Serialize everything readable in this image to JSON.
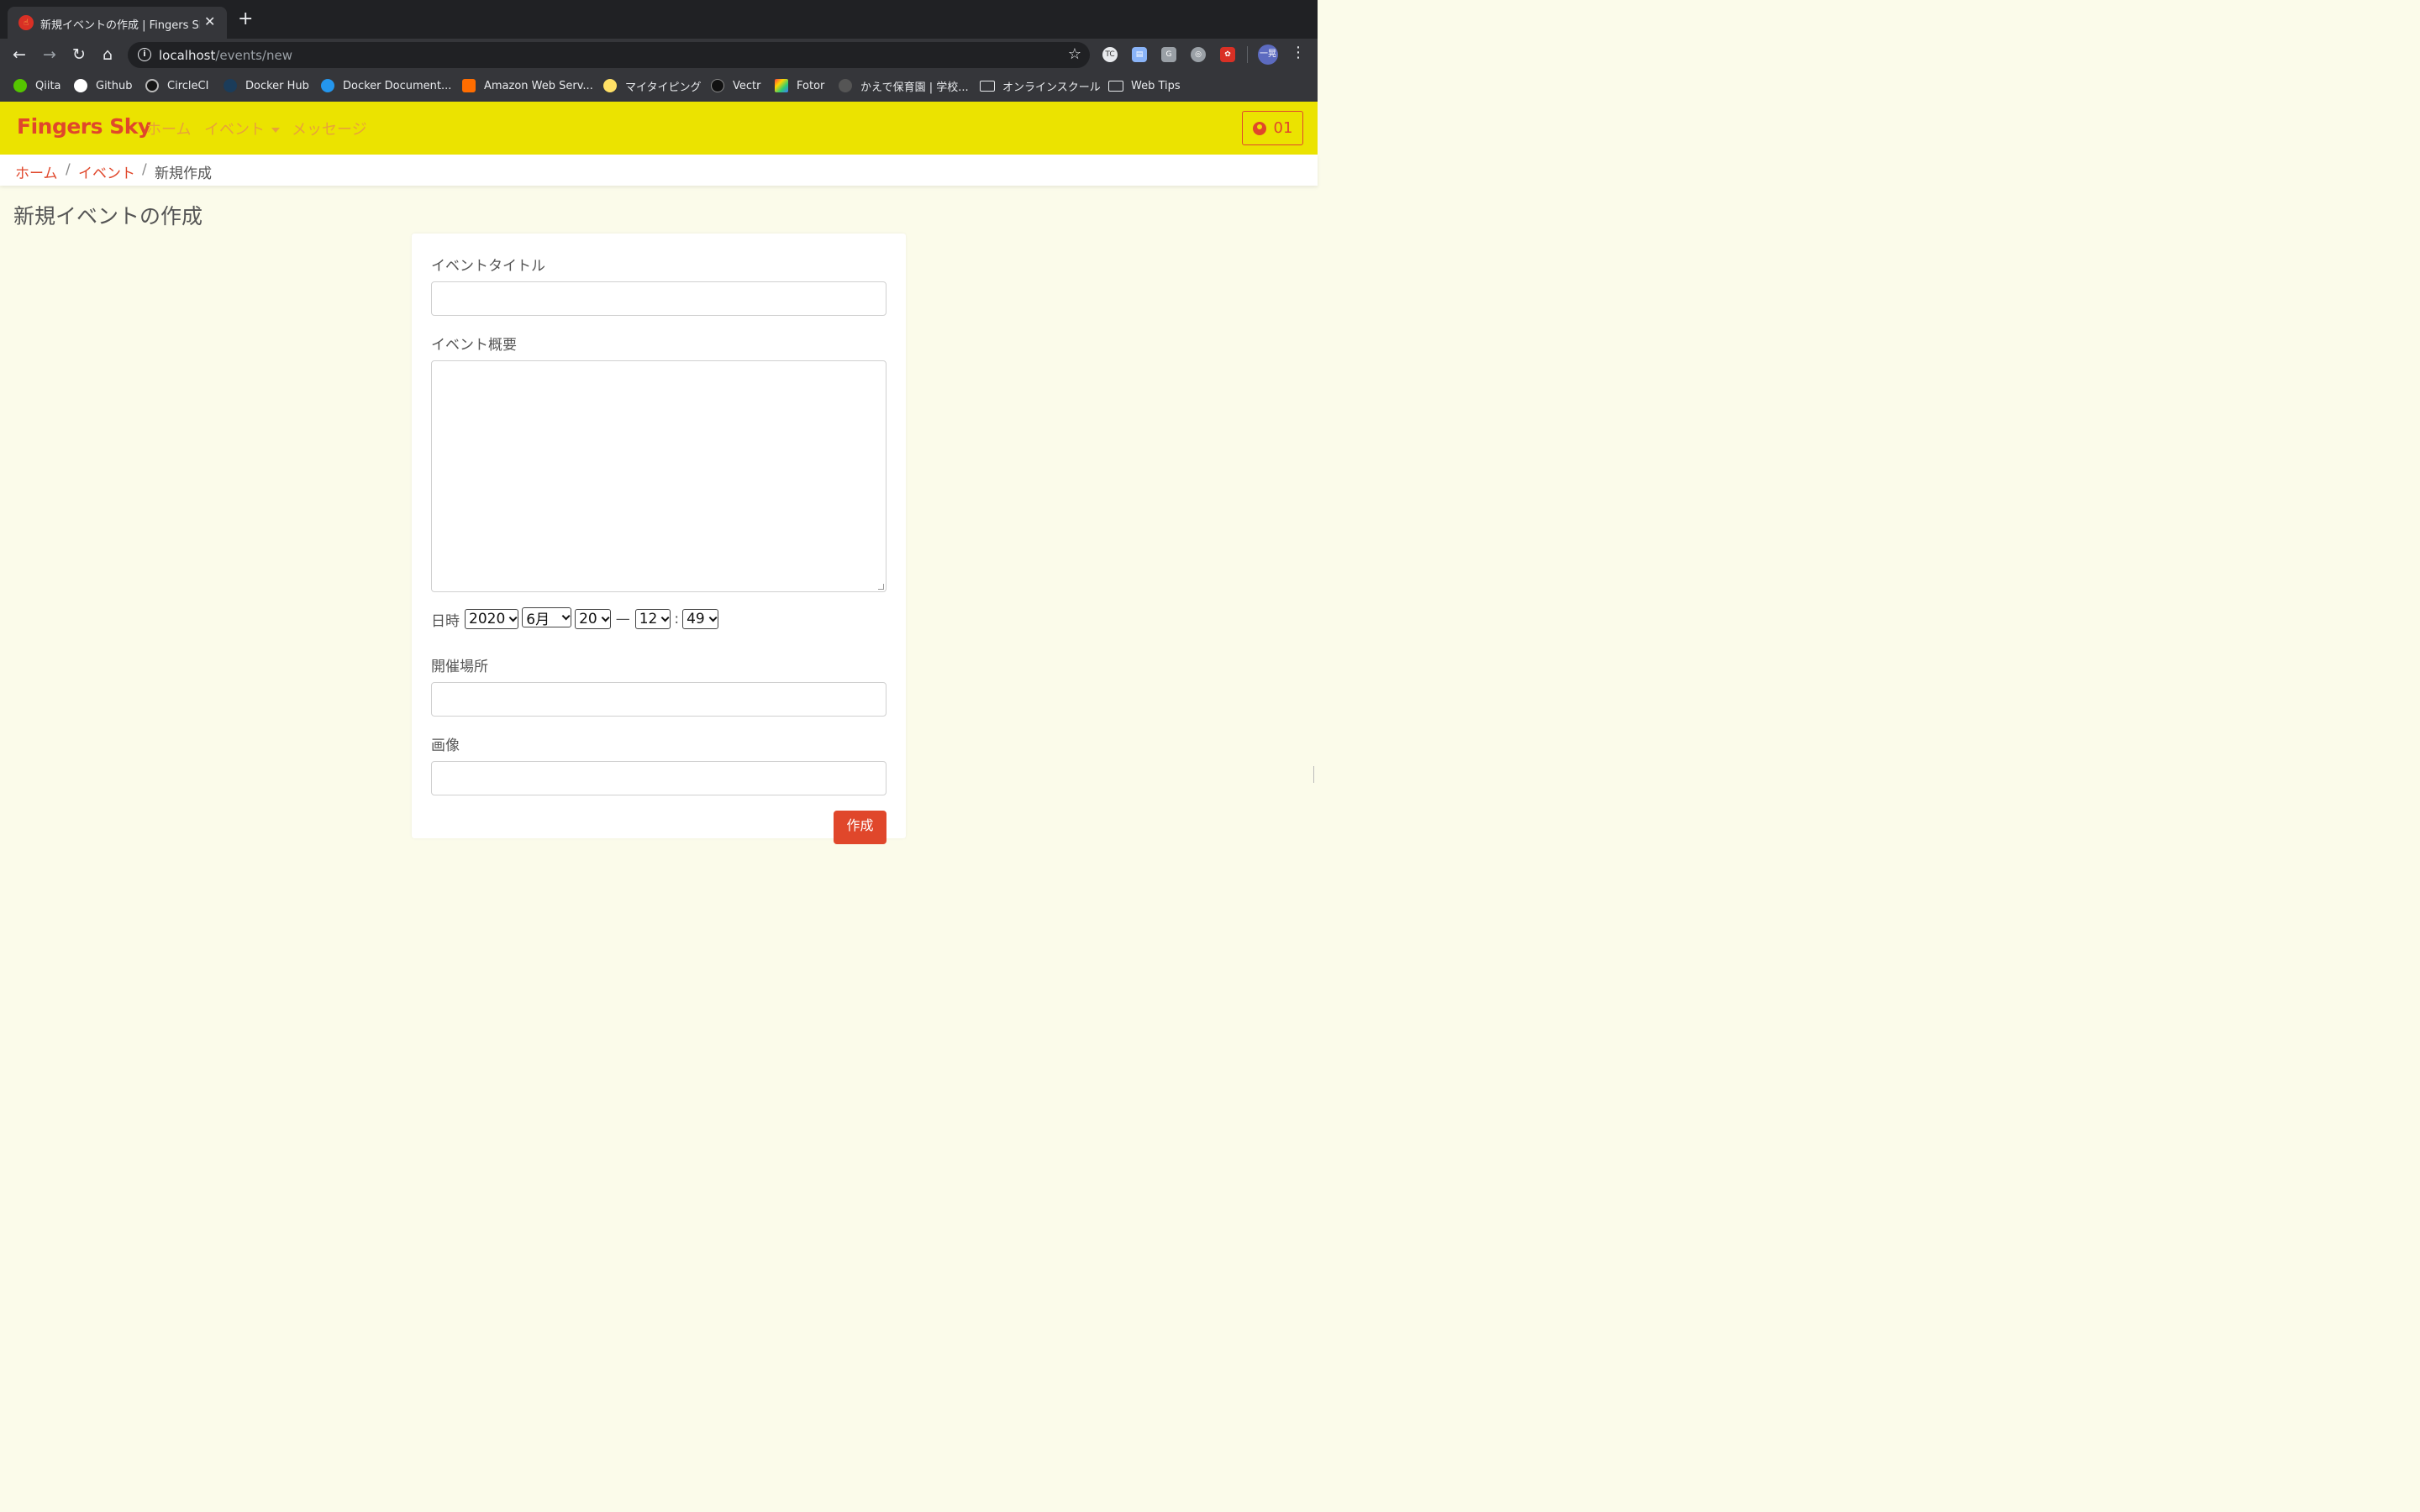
{
  "browser": {
    "tab_title": "新規イベントの作成 | Fingers Sky",
    "url_host": "localhost",
    "url_path": "/events/new",
    "profile_initials": "一晃",
    "bookmarks": [
      {
        "label": "Qiita",
        "color": "#55c500"
      },
      {
        "label": "Github",
        "color": "#ffffff"
      },
      {
        "label": "CircleCI",
        "color": "#161616"
      },
      {
        "label": "Docker Hub",
        "color": "#1d63ed"
      },
      {
        "label": "Docker Document...",
        "color": "#2496ed"
      },
      {
        "label": "Amazon Web Serv...",
        "color": "#ff9900"
      },
      {
        "label": "マイタイピング",
        "color": "#ffe066"
      },
      {
        "label": "Vectr",
        "color": "#111111"
      },
      {
        "label": "Fotor",
        "color": "#f4b400"
      },
      {
        "label": "かえで保育園 | 学校...",
        "color": "#777777"
      },
      {
        "label": "オンラインスクール",
        "color": "folder"
      },
      {
        "label": "Web Tips",
        "color": "folder"
      }
    ]
  },
  "navbar": {
    "brand": "Fingers Sky",
    "links": [
      "ホーム",
      "イベント",
      "メッセージ"
    ],
    "user_label": "01"
  },
  "breadcrumb": {
    "home": "ホーム",
    "sep": "/",
    "events": "イベント",
    "current": "新規作成"
  },
  "page": {
    "title": "新規イベントの作成"
  },
  "form": {
    "title_label": "イベントタイトル",
    "title_value": "",
    "summary_label": "イベント概要",
    "summary_value": "",
    "datetime_label": "日時",
    "year": "2020",
    "month": "6月",
    "day": "20",
    "dash": "—",
    "hour": "12",
    "colon": ":",
    "minute": "49",
    "place_label": "開催場所",
    "place_value": "",
    "image_label": "画像",
    "image_value": "",
    "submit_label": "作成"
  },
  "colors": {
    "navbar_bg": "#ebe300",
    "brand": "#e0472b",
    "nav_link": "#e8a23a",
    "page_bg": "#fbfbea",
    "submit_bg": "#e0472b"
  }
}
